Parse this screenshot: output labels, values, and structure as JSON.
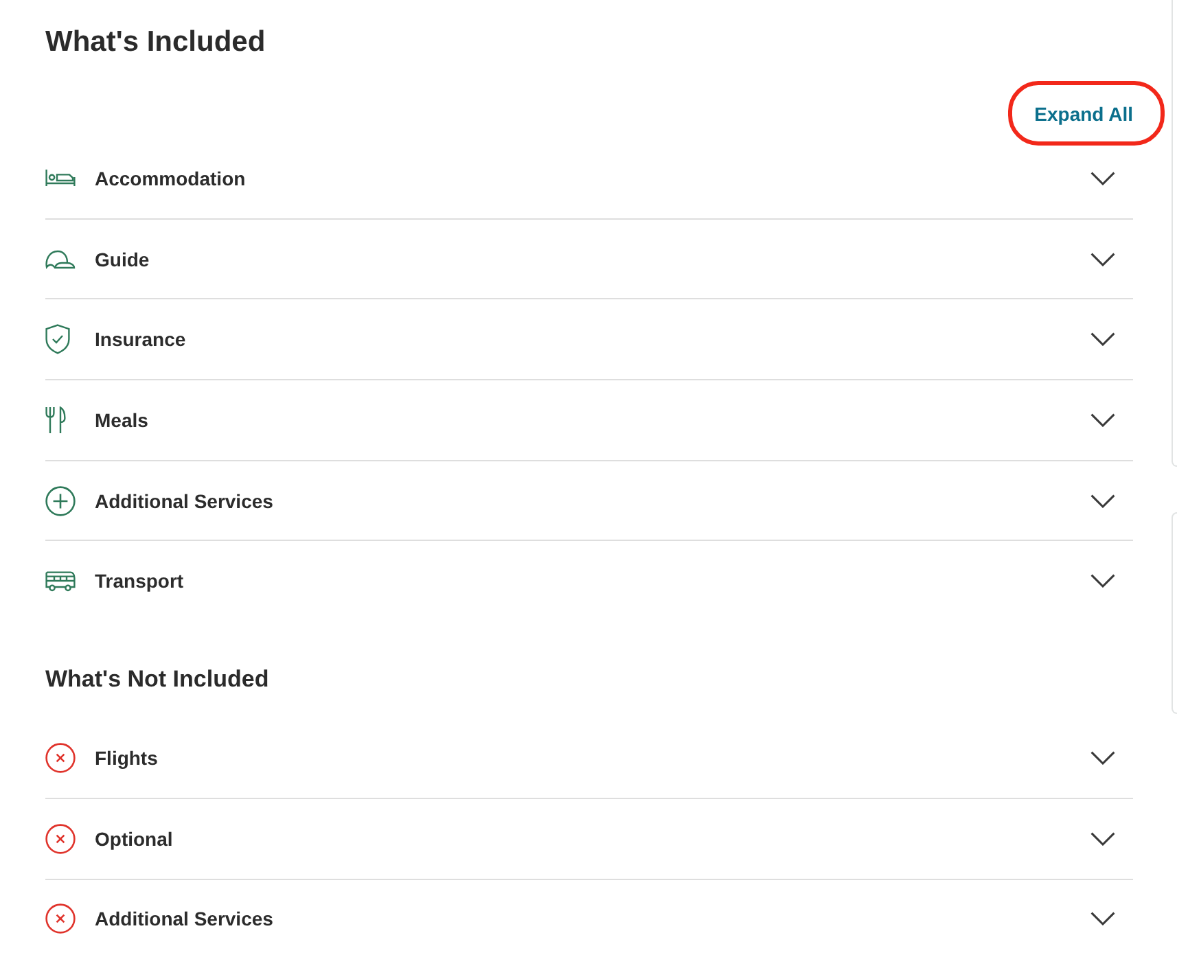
{
  "included": {
    "title": "What's Included",
    "expand_all": {
      "label": "Expand All",
      "highlighted": true
    },
    "items": [
      {
        "label": "Accommodation",
        "kind": "bed",
        "expanded": false
      },
      {
        "label": "Guide",
        "kind": "cap",
        "expanded": false
      },
      {
        "label": "Insurance",
        "kind": "shield",
        "expanded": false
      },
      {
        "label": "Meals",
        "kind": "cutlery",
        "expanded": false
      },
      {
        "label": "Additional Services",
        "kind": "plus",
        "expanded": false
      },
      {
        "label": "Transport",
        "kind": "van",
        "expanded": false
      }
    ]
  },
  "not_included": {
    "title": "What's Not Included",
    "items": [
      {
        "label": "Flights",
        "kind": "cross",
        "expanded": false
      },
      {
        "label": "Optional",
        "kind": "cross",
        "expanded": false
      },
      {
        "label": "Additional Services",
        "kind": "cross",
        "expanded": false
      }
    ]
  }
}
